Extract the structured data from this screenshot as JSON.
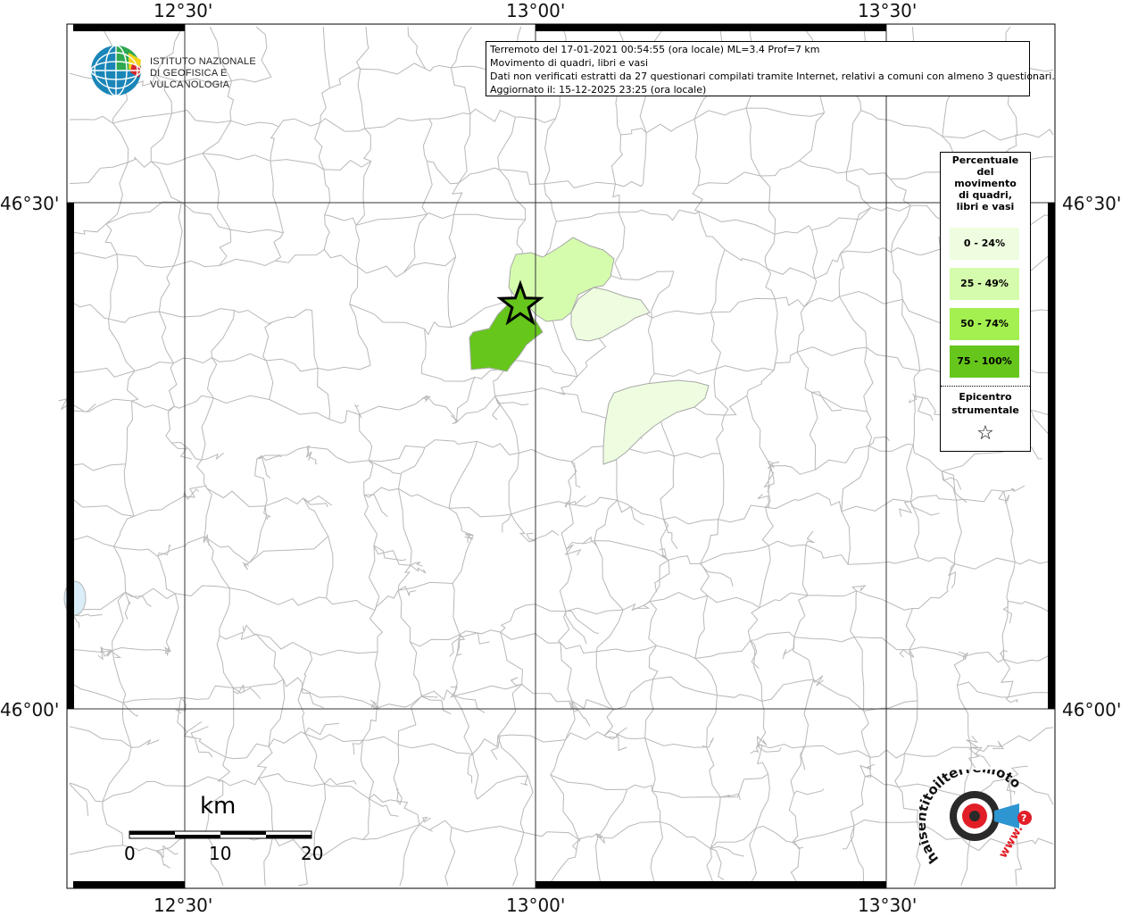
{
  "axes": {
    "top": [
      "12°30'",
      "13°00'",
      "13°30'"
    ],
    "bottom": [
      "12°30'",
      "13°00'",
      "13°30'"
    ],
    "left": [
      "46°30'",
      "46°00'"
    ],
    "right": [
      "46°30'",
      "46°00'"
    ]
  },
  "info": {
    "line1": "Terremoto del 17-01-2021 00:54:55 (ora locale) ML=3.4 Prof=7 km",
    "line2": "Movimento di quadri, libri e vasi",
    "line3": "Dati non verificati estratti da 27 questionari compilati tramite Internet, relativi a comuni con almeno 3 questionari.",
    "line4": "Aggiornato il: 15-12-2025 23:25 (ora locale)"
  },
  "logo": {
    "line1": "ISTITUTO NAZIONALE",
    "line2": "DI GEOFISICA E VULCANOLOGIA"
  },
  "legend": {
    "title": [
      "Percentuale",
      "del",
      "movimento",
      "di quadri,",
      "libri e vasi"
    ],
    "classes": [
      {
        "label": "0 - 24%",
        "color": "#eefde0"
      },
      {
        "label": "25 - 49%",
        "color": "#d5fcad"
      },
      {
        "label": "50 - 74%",
        "color": "#a3f050"
      },
      {
        "label": "75 - 100%",
        "color": "#66c61c"
      }
    ],
    "epicenter": [
      "Epicentro",
      "strumentale"
    ],
    "star_symbol": "☆"
  },
  "scale": {
    "unit": "km",
    "ticks": [
      "0",
      "10",
      "20"
    ]
  },
  "brand": {
    "text": "haisentitoilterremoto.it",
    "www": "www."
  },
  "colors": {
    "boundary": "#b8b8b8",
    "grid": "#333333",
    "frame": "#000000"
  }
}
